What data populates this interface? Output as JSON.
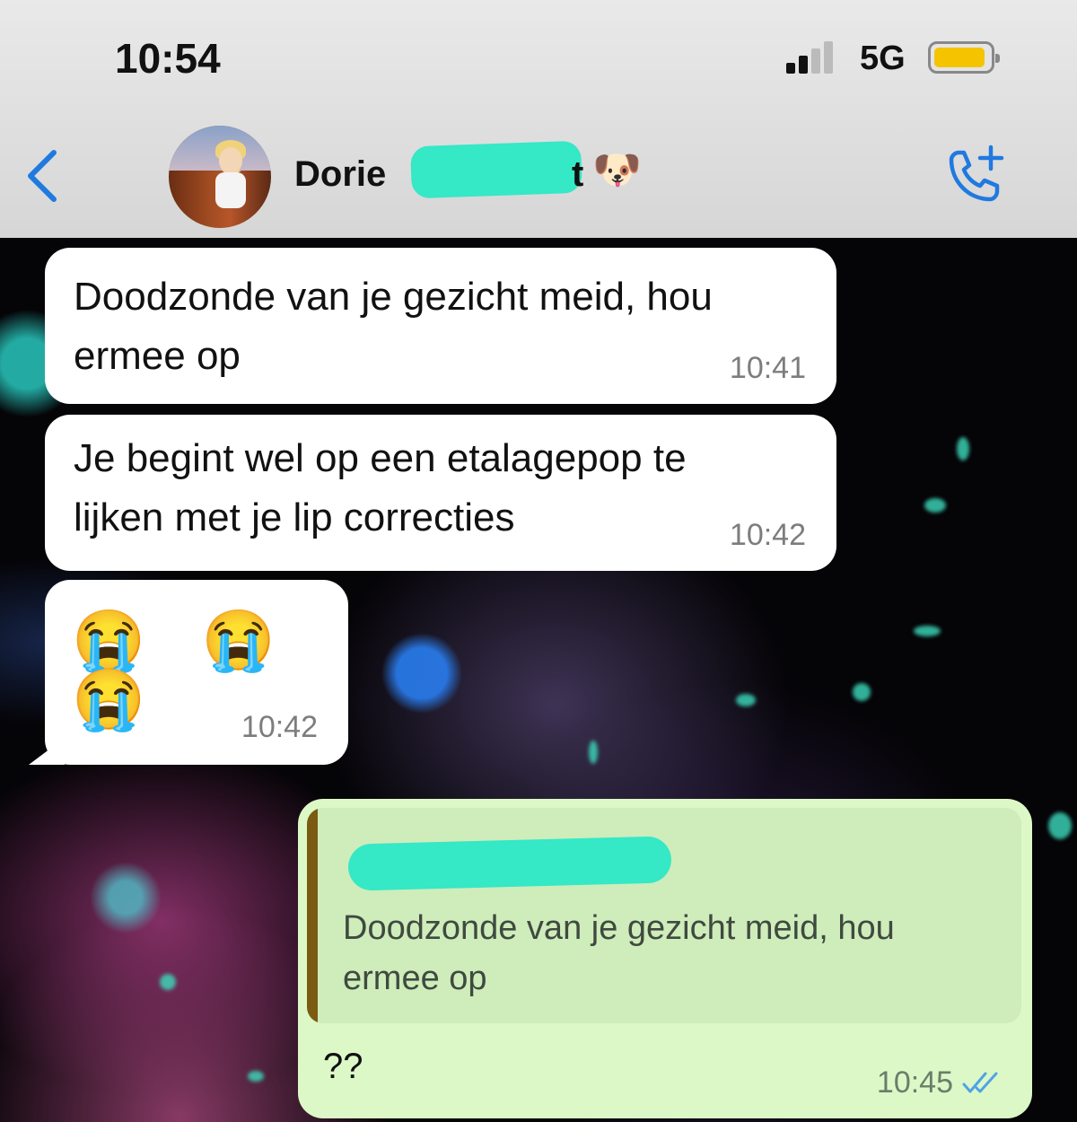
{
  "status_bar": {
    "time": "10:54",
    "network": "5G",
    "signal_bars_filled": 2,
    "signal_bars_total": 4,
    "battery_color": "#f5c400"
  },
  "header": {
    "contact_name_visible": "Dorie",
    "name_tail_visible": "t",
    "contact_emoji": "🐶",
    "back_icon": "chevron-left-icon",
    "call_icon": "add-call-icon",
    "accent_color": "#1f7ae0"
  },
  "messages": [
    {
      "direction": "incoming",
      "text": "Doodzonde van je gezicht meid, hou ermee op",
      "time": "10:41"
    },
    {
      "direction": "incoming",
      "text": "Je begint wel op een etalagepop te lijken met je lip correcties",
      "time": "10:42"
    },
    {
      "direction": "incoming",
      "text": "😭 😭 😭",
      "time": "10:42"
    },
    {
      "direction": "outgoing",
      "quoted_text": "Doodzonde van je gezicht meid, hou ermee op",
      "text": "??",
      "time": "10:45",
      "status_icon": "double-check-icon",
      "status_color": "#4fa3e8"
    }
  ],
  "colors": {
    "incoming_bubble": "#ffffff",
    "outgoing_bubble": "#dcf8c6",
    "redaction": "#35e8c6"
  }
}
